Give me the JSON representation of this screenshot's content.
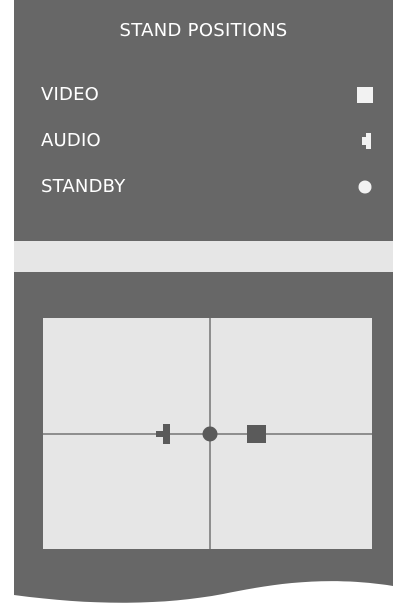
{
  "title": "STAND POSITIONS",
  "menu": {
    "items": [
      {
        "label": "VIDEO",
        "icon": "square-icon"
      },
      {
        "label": "AUDIO",
        "icon": "speaker-icon"
      },
      {
        "label": "STANDBY",
        "icon": "circle-icon"
      }
    ]
  },
  "diagram": {
    "markers": [
      "speaker-icon",
      "circle-icon",
      "square-icon"
    ]
  },
  "colors": {
    "panel": "#676767",
    "strip": "#e6e6e6",
    "canvas": "#e6e6e6",
    "crosshair": "#8f8f8f",
    "marker": "#5a5a5a",
    "menu_icon": "#f2f2f2"
  }
}
